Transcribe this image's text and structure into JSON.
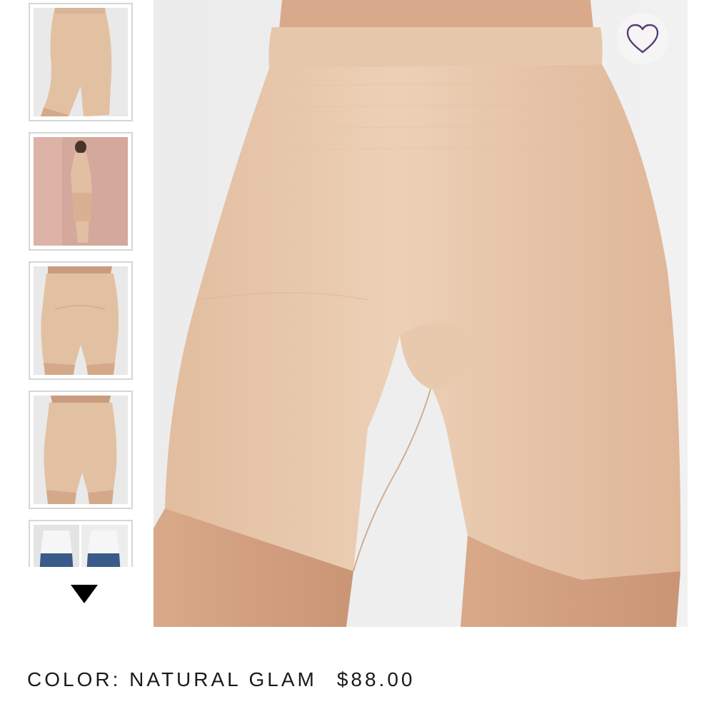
{
  "product": {
    "color_label": "COLOR: NATURAL GLAM",
    "price": "$88.00"
  },
  "thumbnails": [
    {
      "name": "thumbnail-1",
      "view": "side"
    },
    {
      "name": "thumbnail-2",
      "view": "full-body-back"
    },
    {
      "name": "thumbnail-3",
      "view": "back"
    },
    {
      "name": "thumbnail-4",
      "view": "front"
    },
    {
      "name": "thumbnail-5",
      "view": "before-after"
    }
  ],
  "icons": {
    "wishlist": "heart-icon",
    "scroll_down": "triangle-down-icon"
  },
  "colors": {
    "fabric": "#e6c5a8",
    "heart_stroke": "#5a3d7a",
    "thumb_border": "#d6d6d6",
    "text": "#1a1a1a"
  }
}
